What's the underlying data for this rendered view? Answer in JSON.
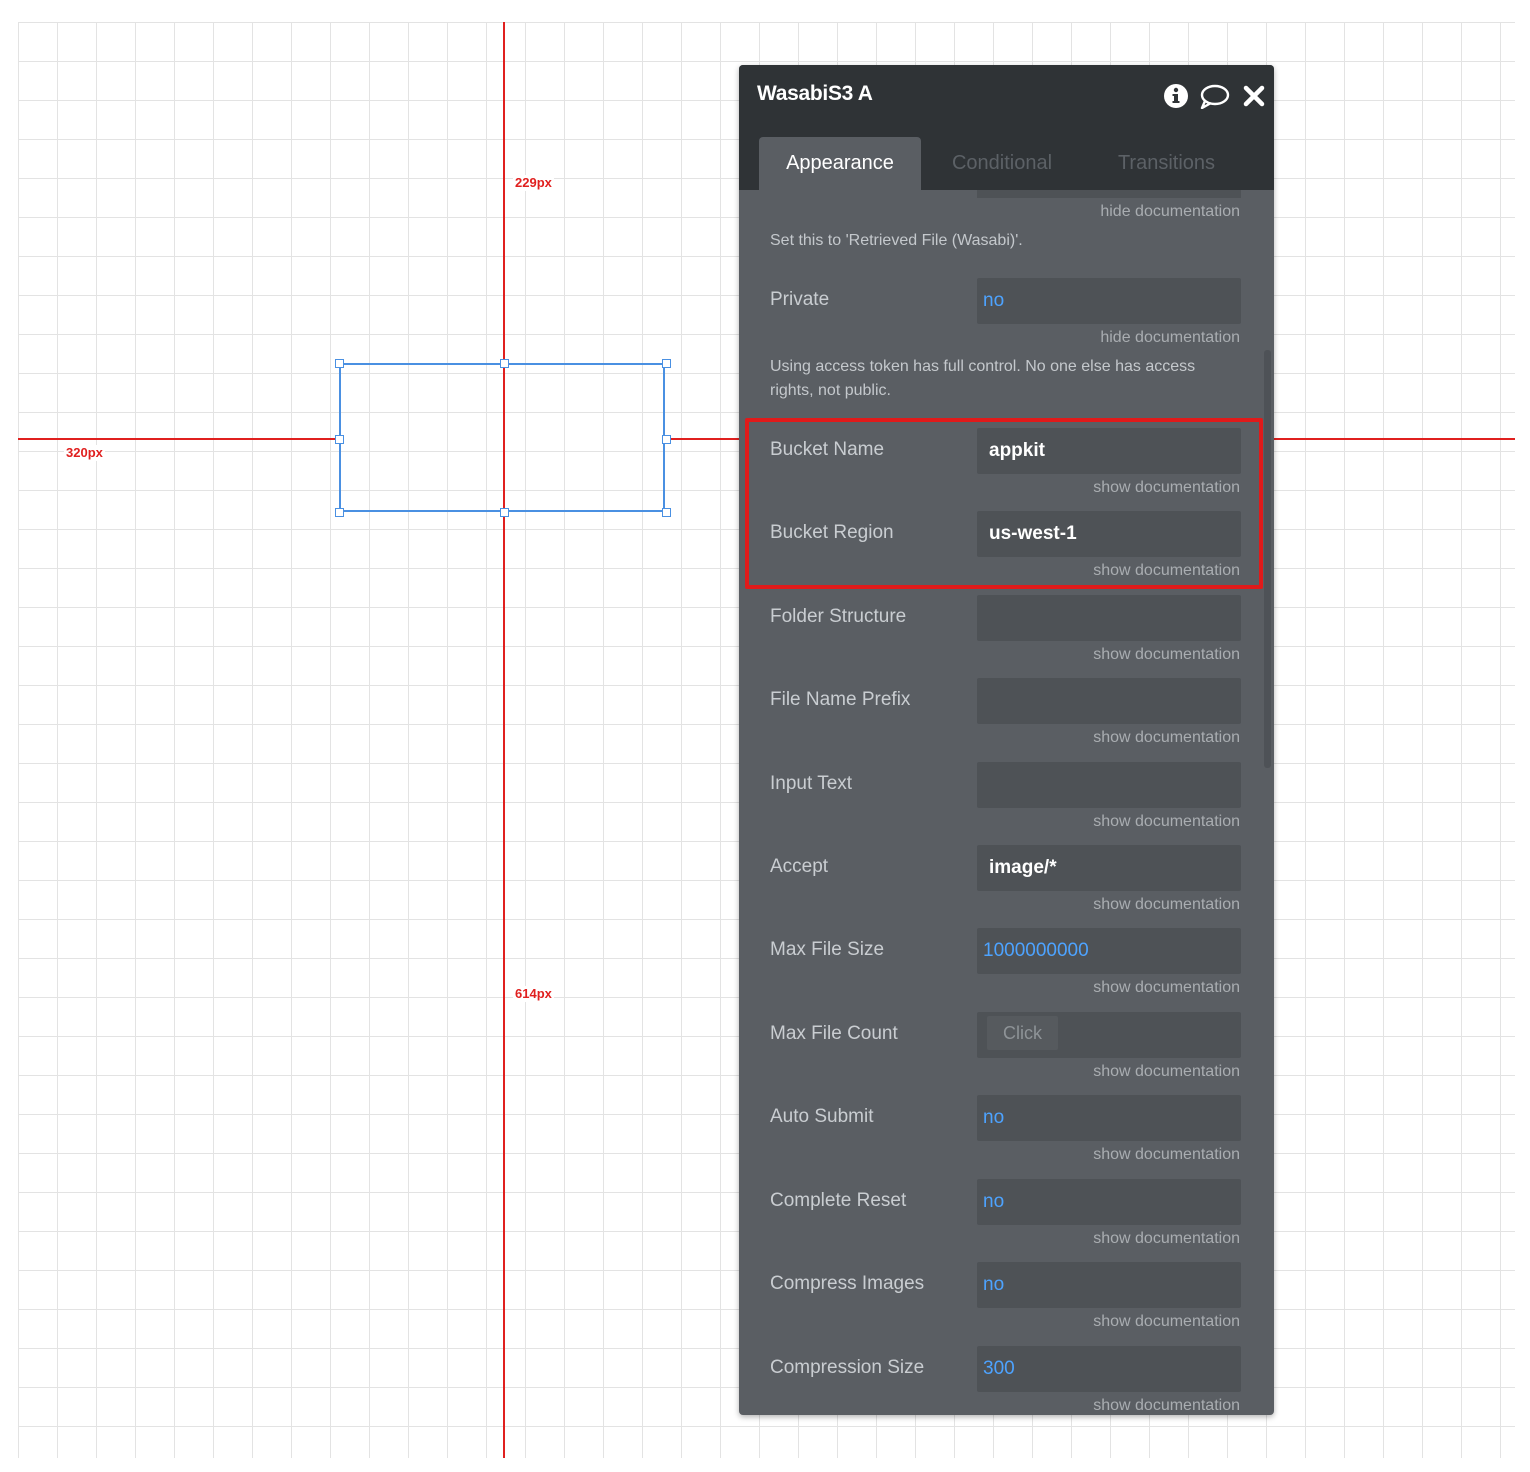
{
  "canvas": {
    "guides": {
      "top_distance": "229px",
      "left_distance": "320px",
      "bottom_distance": "614px"
    }
  },
  "panel": {
    "title": "WasabiS3 A",
    "icons": {
      "info": "info-icon",
      "comment": "comment-icon",
      "close": "close-icon"
    },
    "tabs": [
      {
        "label": "Appearance",
        "active": true
      },
      {
        "label": "Conditional",
        "active": false
      },
      {
        "label": "Transitions",
        "active": false
      }
    ],
    "top_doc": {
      "link": "hide documentation",
      "text": "Set this to 'Retrieved File (Wasabi)'."
    },
    "private": {
      "label": "Private",
      "value": "no",
      "doc_link": "hide documentation",
      "doc_text": "Using access token has full control. No one else has access rights, not public."
    },
    "fields": [
      {
        "label": "Bucket Name",
        "value": "appkit",
        "doc": "show documentation"
      },
      {
        "label": "Bucket Region",
        "value": "us-west-1",
        "doc": "show documentation"
      },
      {
        "label": "Folder Structure",
        "value": "",
        "doc": "show documentation"
      },
      {
        "label": "File Name Prefix",
        "value": "",
        "doc": "show documentation"
      },
      {
        "label": "Input Text",
        "value": "",
        "doc": "show documentation"
      },
      {
        "label": "Accept",
        "value": "image/*",
        "doc": "show documentation"
      },
      {
        "label": "Max File Size",
        "value": "1000000000",
        "doc": "show documentation"
      },
      {
        "label": "Max File Count",
        "value": "Click",
        "doc": "show documentation"
      },
      {
        "label": "Auto Submit",
        "value": "no",
        "doc": "show documentation"
      },
      {
        "label": "Complete Reset",
        "value": "no",
        "doc": "show documentation"
      },
      {
        "label": "Compress Images",
        "value": "no",
        "doc": "show documentation"
      },
      {
        "label": "Compression Size",
        "value": "300",
        "doc": "show documentation"
      }
    ]
  },
  "colors": {
    "guide": "#e0201f",
    "selection": "#4a90e2",
    "highlight": "#e01a1a",
    "dynamic_value": "#4da3ff"
  }
}
